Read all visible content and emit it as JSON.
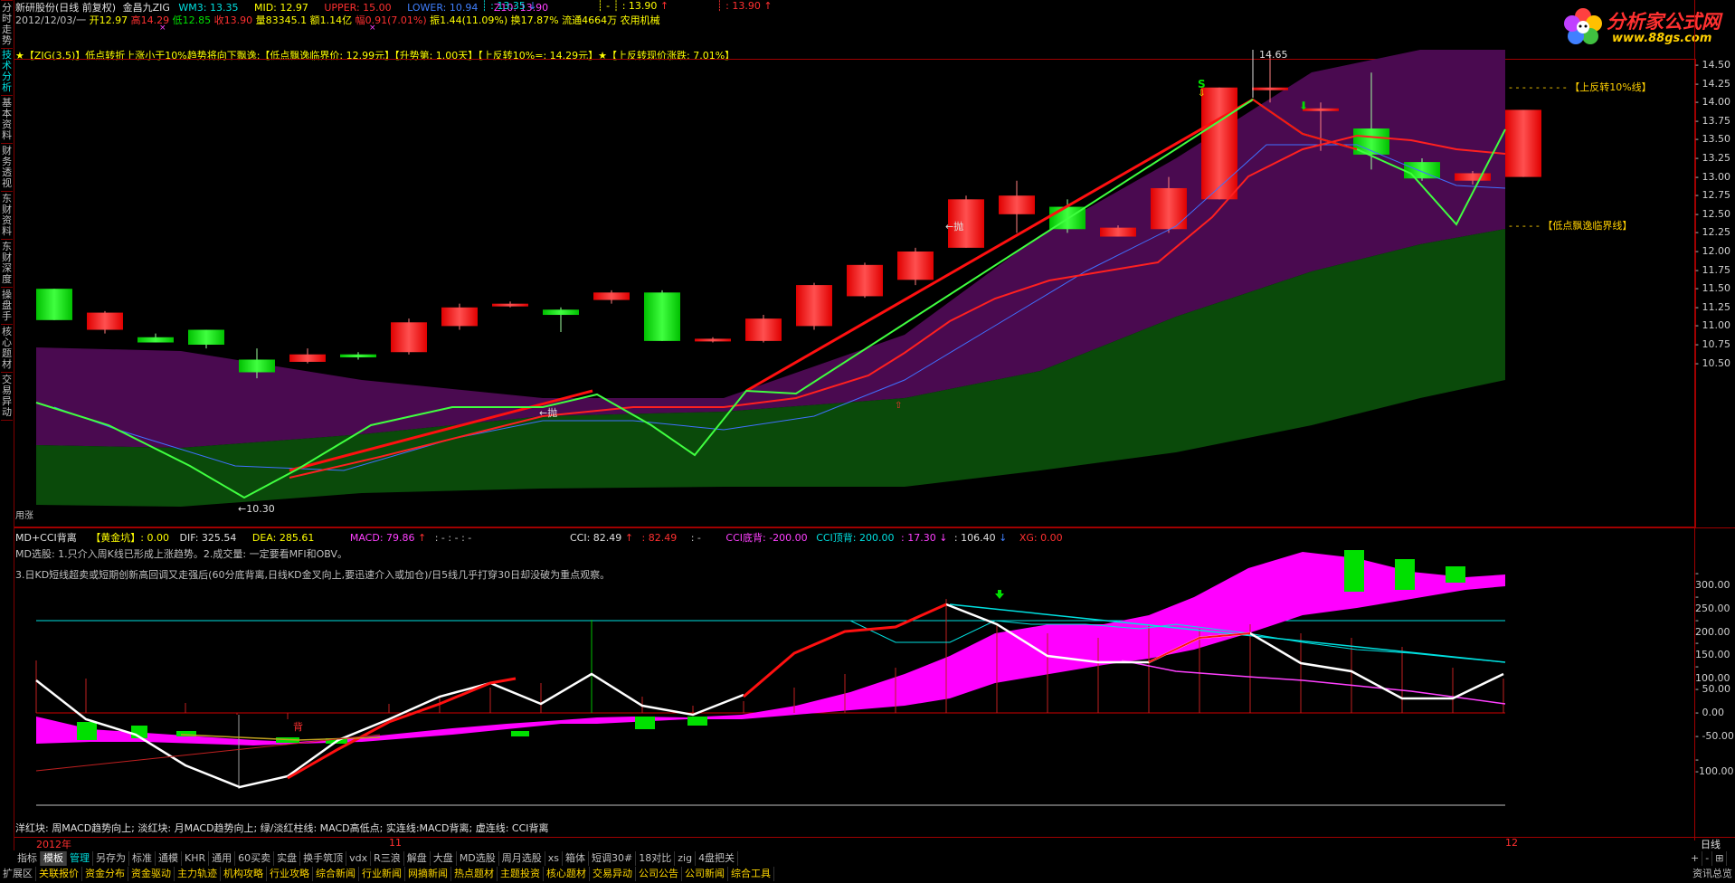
{
  "sidebar_tabs": [
    "分时走势",
    "技术分析",
    "基本资料",
    "财务透视",
    "东财资料",
    "东财深度",
    "操盘手",
    "核心题材",
    "交易异动"
  ],
  "header": {
    "row1": {
      "stock": "新研股份(日线 前复权)",
      "formula": "金昌九ZIG",
      "wm3": "WM3: 13.35",
      "mid": "MID: 12.97",
      "upper": "UPPER: 15.00",
      "lower": "LOWER: 10.94",
      "z10": "Z10: 13.90",
      "v1": ": 13.35",
      "v2": ": 13.90",
      "v3": ": 13.90"
    },
    "row2": {
      "date": "2012/12/03/一",
      "open": "开12.97",
      "high": "高14.29",
      "low": "低12.85",
      "close": "收13.90",
      "vol": "量83345.1",
      "amount": "额1.14亿",
      "change": "幅0.91(7.01%)",
      "amplitude": "振1.44(11.09%)",
      "turnover": "换17.87%",
      "float": "流通4664万",
      "industry": "农用机械"
    },
    "zig_note": "★【ZIG(3,5)】低点转折上涨小于10%趋势将向下飘逸:【低点飘逸临界价: 12.99元】【升势第: 1.00天】【上反转10%=: 14.29元】★【上反转现价涨跌: 7.01%】"
  },
  "price_axis": [
    "14.50",
    "14.25",
    "14.00",
    "13.75",
    "13.50",
    "13.25",
    "13.00",
    "12.75",
    "12.50",
    "12.25",
    "12.00",
    "11.75",
    "11.50",
    "11.25",
    "11.00",
    "10.75",
    "10.50"
  ],
  "annotations": {
    "high_label": "14.65",
    "low_label": "←10.30",
    "throw1": "←抛",
    "throw2": "←抛",
    "s_label": "S",
    "upper_line_label": "【上反转10%线】",
    "lower_line_label": "【低点飘逸临界线】",
    "bottom_left": "用涨"
  },
  "indicator": {
    "header": {
      "name": "MD+CCI背离",
      "gold": "【黄金坑】: 0.00",
      "dif": "DIF: 325.54",
      "dea": "DEA: 285.61",
      "macd": "MACD: 79.86",
      "macd_extra": ": -  : -  : -",
      "cci": "CCI: 82.49",
      "cci2": ": 82.49",
      "cci3": ": -",
      "cci_bottom": "CCI底背: -200.00",
      "cci_top": "CCI顶背: 200.00",
      "v17": ": 17.30",
      "v106": ": 106.40",
      "xg": "XG: 0.00"
    },
    "note1": "MD选股: 1.只介入周K线已形成上涨趋势。2.成交量: 一定要看MFI和OBV。",
    "note2": "3.日KD短线超卖或短期创新高回调又走强后(60分底背离,日线KD金叉向上,要迅速介入或加仓)/日5线几乎打穿30日却没破为重点观察。",
    "axis": [
      "300.00",
      "250.00",
      "200.00",
      "150.00",
      "100.00",
      "50.00",
      "0.00",
      "-50.00",
      "-100.00"
    ],
    "legend": "洋红块: 周MACD趋势向上; 淡红块: 月MACD趋势向上; 绿/淡红柱线: MACD高低点; 实连线:MACD背离; 虚连线: CCI背离",
    "bei_label": "背"
  },
  "date_axis": {
    "y2012": "2012年",
    "m11": "11",
    "m12": "12",
    "period": "日线"
  },
  "toolbar1": [
    "指标",
    "模板",
    "管理",
    "另存为",
    "标准",
    "通模",
    "KHR",
    "通用",
    "60买卖",
    "实盘",
    "换手筑顶",
    "vdx",
    "R三浪",
    "解盘",
    "大盘",
    "MD选股",
    "周月选股",
    "xs",
    "箱体",
    "短调30#",
    "18对比",
    "zig",
    "4盘把关"
  ],
  "toolbar1_active": "模板",
  "toolbar1_right": [
    "+",
    "-",
    "⊞"
  ],
  "toolbar2": [
    "扩展区",
    "关联报价",
    "资金分布",
    "资金驱动",
    "主力轨迹",
    "机构攻略",
    "行业攻略",
    "综合新闻",
    "行业新闻",
    "网摘新闻",
    "热点题材",
    "主题投资",
    "核心题材",
    "交易异动",
    "公司公告",
    "公司新闻",
    "综合工具"
  ],
  "toolbar2_right": "资讯总览",
  "logo": {
    "text": "分析家公式网",
    "url": "www.88gs.com"
  },
  "colors": {
    "candle_up": "#e00000",
    "candle_down": "#00c000",
    "band_upper": "#4a0a50",
    "band_lower": "#0a4a0a",
    "zig_green": "#40ff40",
    "ma_red": "#ff1010",
    "ma_blue": "#4070ff",
    "magenta": "#ff00ff"
  }
}
